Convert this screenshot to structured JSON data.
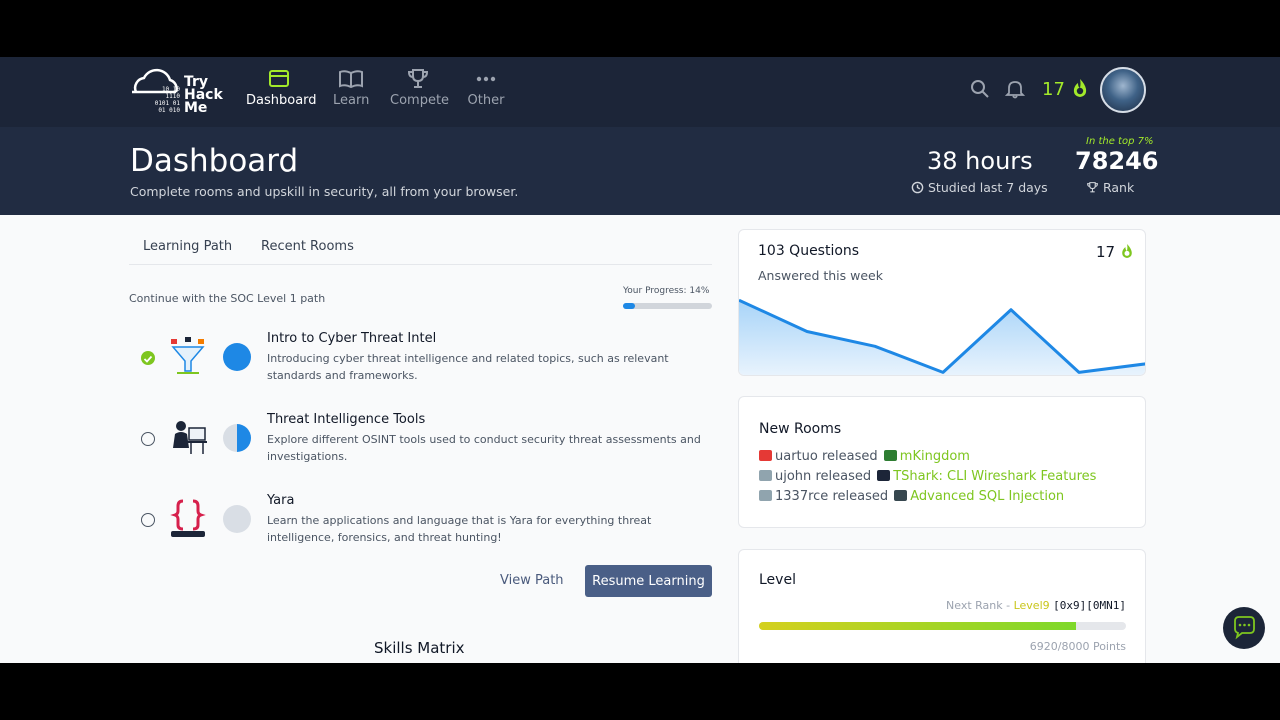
{
  "brand": {
    "line1": "Try",
    "line2": "Hack",
    "line3": "Me",
    "digits": [
      "10 10",
      "1110",
      "0101 01",
      "01 010"
    ]
  },
  "nav": {
    "items": [
      {
        "label": "Dashboard",
        "icon": "dashboard-icon",
        "active": true
      },
      {
        "label": "Learn",
        "icon": "book-icon",
        "active": false
      },
      {
        "label": "Compete",
        "icon": "trophy-icon",
        "active": false
      },
      {
        "label": "Other",
        "icon": "more-icon",
        "active": false
      }
    ],
    "streak": "17"
  },
  "hero": {
    "title": "Dashboard",
    "subtitle": "Complete rooms and upskill in security, all from your browser.",
    "hours_value": "38 hours",
    "hours_label": "Studied last 7 days",
    "top_label": "In the top 7%",
    "rank_value": "78246",
    "rank_label": "Rank"
  },
  "tabs": [
    "Learning Path",
    "Recent Rooms"
  ],
  "path": {
    "continue_text": "Continue with the SOC Level 1 path",
    "progress_label": "Your Progress: 14%",
    "progress_fraction": 0.14,
    "rooms": [
      {
        "title": "Intro to Cyber Threat Intel",
        "desc": "Introducing cyber threat intelligence and related topics, such as relevant standards and frameworks.",
        "completed": true,
        "progress": "full"
      },
      {
        "title": "Threat Intelligence Tools",
        "desc": "Explore different OSINT tools used to conduct security threat assessments and investigations.",
        "completed": false,
        "progress": "half"
      },
      {
        "title": "Yara",
        "desc": "Learn the applications and language that is Yara for everything threat intelligence, forensics, and threat hunting!",
        "completed": false,
        "progress": "none"
      }
    ],
    "view_path": "View Path",
    "resume": "Resume Learning"
  },
  "skills_title": "Skills Matrix",
  "questions": {
    "title": "103 Questions",
    "subtitle": "Answered this week",
    "streak": "17",
    "chart_data": {
      "type": "area",
      "values": [
        86,
        50,
        33,
        3,
        75,
        3,
        13
      ]
    }
  },
  "new_rooms": {
    "title": "New Rooms",
    "items": [
      {
        "user": "uartuo",
        "verb": "released",
        "room": "mKingdom"
      },
      {
        "user": "ujohn",
        "verb": "released",
        "room": "TShark: CLI Wireshark Features"
      },
      {
        "user": "1337rce",
        "verb": "released",
        "room": "Advanced SQL Injection"
      }
    ]
  },
  "level": {
    "title": "Level",
    "next_rank_prefix": "Next Rank - ",
    "next_level": "Level9",
    "next_code": "[0x9][0MN1]",
    "points": "6920/8000 Points",
    "points_fraction": 0.865
  },
  "colors": {
    "accent_green": "#a3ea2a",
    "link_green": "#7ec61f",
    "blue": "#1e88e5",
    "nav_bg": "#1c2538"
  }
}
